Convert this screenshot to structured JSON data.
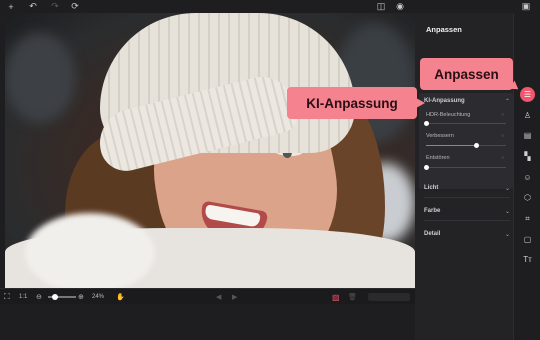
{
  "topbar": {
    "icons": [
      "plus-icon",
      "undo-icon",
      "redo-icon",
      "refresh-icon",
      "compare-icon",
      "eye-icon",
      "save-icon"
    ]
  },
  "bottombar": {
    "ratio_label": "1:1",
    "zoom_percent": "24%",
    "zoom_level": 0.24
  },
  "panel": {
    "title": "Anpassen",
    "sections": {
      "ki": {
        "label": "KI-Anpassung"
      },
      "licht": {
        "label": "Licht"
      },
      "farbe": {
        "label": "Farbe"
      },
      "detail": {
        "label": "Detail"
      }
    },
    "sliders": [
      {
        "label": "HDR-Beleuchtung",
        "value": 0
      },
      {
        "label": "Verbessern",
        "value": 0.62
      },
      {
        "label": "Entstören",
        "value": 0
      }
    ]
  },
  "callouts": {
    "adjust": "Anpassen",
    "ai_adjust": "KI-Anpassung"
  },
  "colors": {
    "accent": "#f0566c",
    "callout": "#f5828f",
    "panel_bg": "#232326",
    "app_bg": "#1e1e20"
  }
}
